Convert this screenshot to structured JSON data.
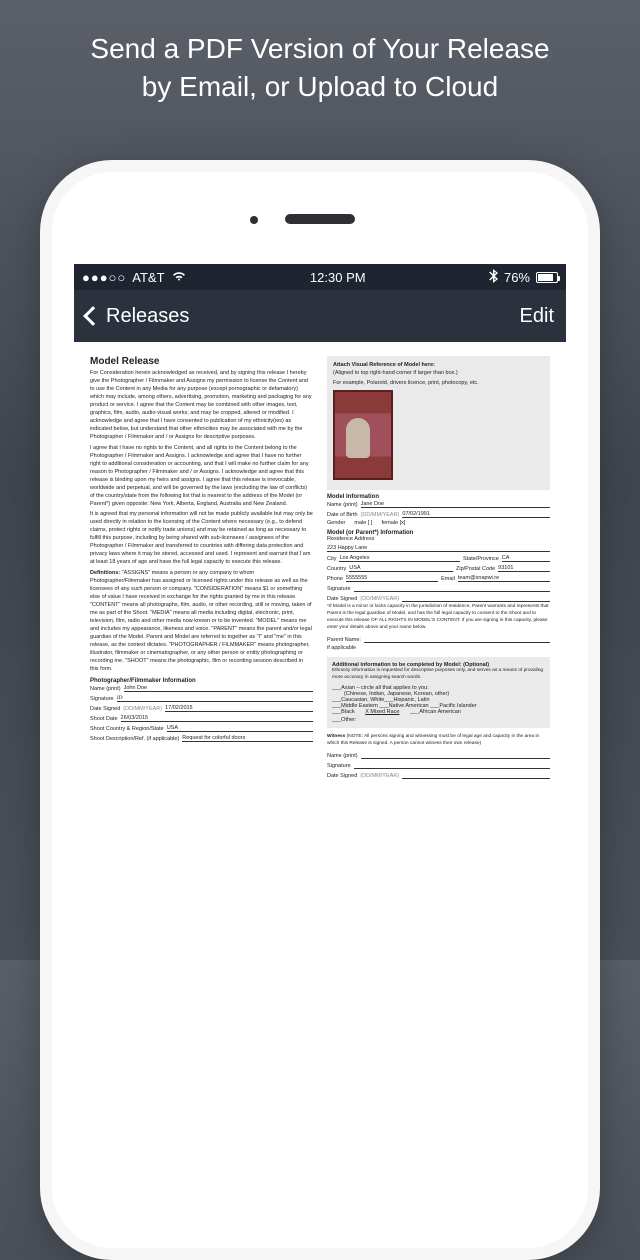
{
  "promo": {
    "line1": "Send a PDF Version of Your Release",
    "line2": "by Email, or Upload to Cloud"
  },
  "status": {
    "carrier": "AT&T",
    "time": "12:30 PM",
    "battery": "76%"
  },
  "nav": {
    "back": "Releases",
    "right": "Edit"
  },
  "doc": {
    "title": "Model Release",
    "para1": "For Consideration herein acknowledged as received, and by signing this release I hereby give the Photographer / Filmmaker and Assigns my permission to license the Content and to use the Content in any Media for any purpose (except pornographic or defamatory) which may include, among others, advertising, promotion, marketing and packaging for any product or service. I agree that the Content may be combined with other images, text, graphics, film, audio, audio-visual works; and may be cropped, altered or modified. I acknowledge and agree that I have consented to publication of my ethnicity(ies) as indicated below, but understand that other ethnicities may be associated with me by the Photographer / Filmmaker and / or Assigns for descriptive purposes.",
    "para2": "I agree that I have no rights to the Content, and all rights to the Content belong to the Photographer / Filmmaker and Assigns. I acknowledge and agree that I have no further right to additional consideration or accounting, and that I will make no further claim for any reason to Photographer / Filmmaker and / or Assigns. I acknowledge and agree that this release is binding upon my heirs and assigns. I agree that this release is irrevocable, worldwide and perpetual, and will be governed by the laws (excluding the law of conflicts) of the country/state from the following list that is nearest to the address of the Model (or Parent*) given opposite: New York, Alberta, England, Australia and New Zealand.",
    "para3": "It is agreed that my personal information will not be made publicly available but may only be used directly in relation to the licensing of the Content where necessary (e.g., to defend claims, protect rights or notify trade unions) and may be retained as long as necessary to fulfill this purpose, including by being shared with sub-licensees / assignees of the Photographer / Filmmaker and transferred to countries with differing data protection and privacy laws where it may be stored, accessed and used. I represent and warrant that I am at least 18 years of age and have the full legal capacity to execute this release.",
    "definitions_title": "Definitions:",
    "para4": "\"ASSIGNS\" means a person or any company to whom Photographer/Filmmaker has assigned or licensed rights under this release as well as the licensees of any such person or company. \"CONSIDERATION\" means $1 or something else of value I have received in exchange for the rights granted by me in this release. \"CONTENT\" means all photographs, film, audio, or other recording, still or moving, taken of me as part of the Shoot. \"MEDIA\" means all media including digital, electronic, print, television, film, radio and other media now known or to be invented. \"MODEL\" means me and includes my appearance, likeness and voice. \"PARENT\" means the parent and/or legal guardian of the Model. Parent and Model are referred to together as \"I\" and \"me\" in this release, as the context dictates. \"PHOTOGRAPHER / FILMMAKER\" means photographer, illustrator, filmmaker or cinematographer, or any other person or entity photographing or recording me. \"SHOOT\" means the photographic, film or recording session described in this form.",
    "photog_section": "Photographer/Filmmaker Information",
    "photog": {
      "name_label": "Name (print)",
      "name": "John Doe",
      "sig_label": "Signature",
      "date_signed_label": "Date Signed",
      "date_hint": "(DD/MM/YEAR)",
      "date_signed": "17/02/2015",
      "shoot_date_label": "Shoot Date",
      "shoot_date": "26/03/2015",
      "country_label": "Shoot Country & Region/State",
      "country": "USA",
      "desc_label": "Shoot Description/Ref. (if applicable)",
      "desc": "Request for colorful doors"
    },
    "attach": {
      "title": "Attach Visual Reference of Model here:",
      "note1": "(Aligned to top right-hand corner if larger than box.)",
      "note2": "For example, Polaroid, drivers licence, print, photocopy, etc."
    },
    "model_section": "Model Information",
    "model": {
      "name_label": "Name (print)",
      "name": "Jane Doe",
      "dob_label": "Date of Birth",
      "dob_hint": "(DD/MM/YEAR)",
      "dob": "07/02/1991",
      "gender_label": "Gender",
      "gender_male": "male [ ]",
      "gender_female": "female [x]"
    },
    "parent_section": "Model (or Parent*) Information",
    "address_label": "Residence Address",
    "address": "223 Happy Lane",
    "city_label": "City",
    "city": "Los Angeles",
    "state_label": "State/Province",
    "state": "CA",
    "country_label": "Country",
    "country": "USA",
    "zip_label": "Zip/Postal Code",
    "zip": "93101",
    "phone_label": "Phone",
    "phone": "5555555",
    "email_label": "Email",
    "email": "team@snapwi.re",
    "sig_label": "Signature",
    "date_signed_label": "Date Signed",
    "date_hint": "(DD/MM/YEAR)",
    "parent_note": "*If Model is a minor or lacks capacity in the jurisdiction of residence, Parent warrants and represents that Parent is the legal guardian of Model, and has the full legal capacity to consent to the Shoot and to execute this release OF ALL RIGHTS IN MODEL'S CONTENT. If you are signing in this capacity, please enter your details above and your name below.",
    "parent_name_label": "Parent Name:",
    "if_app": "if applicable",
    "optional_title": "Additional information to be completed by Model: (Optional)",
    "optional_note": "Ethnicity information is requested for descriptive purposes only, and serves as a means of providing more accuracy in assigning search words.",
    "eth": {
      "asian": "___Asian – circle all that applies to you:",
      "asian_sub": "(Chinese, Indian, Japanese, Korean, other)",
      "cauc": "___Caucasian, White___Hispanic, Latin",
      "mid": "___Middle Eastern ___Native American ___Pacific Islander",
      "black": "___Black",
      "mixed": "X  Mixed Race",
      "afr": "___African American",
      "other": "___Other:"
    },
    "witness_title": "Witness",
    "witness_note": "(NOTE: All persons signing and witnessing must be of legal age and capacity in the area in which this Release is signed. A person cannot witness their own release)",
    "w_name": "Name (print)",
    "w_sig": "Signature",
    "w_date": "Date Signed"
  }
}
